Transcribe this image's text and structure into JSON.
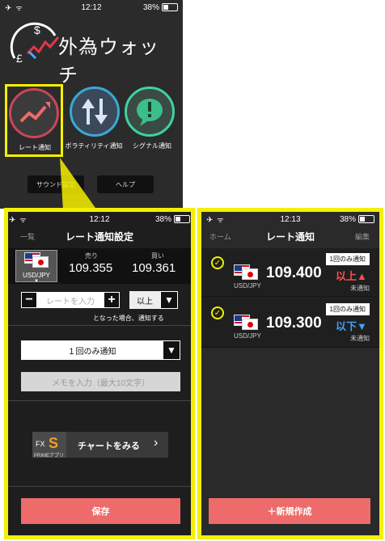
{
  "top_app": {
    "status": {
      "time": "12:12",
      "battery": "38%"
    },
    "logo_text": "外為ウォッチ",
    "buttons": [
      {
        "label": "レート通知"
      },
      {
        "label": "ボラティリティ通知"
      },
      {
        "label": "シグナル通知"
      }
    ],
    "sound_settings": "サウンド設定",
    "help": "ヘルプ"
  },
  "left": {
    "status": {
      "time": "12:12",
      "battery": "38%"
    },
    "nav": {
      "back": "一覧",
      "title": "レート通知設定"
    },
    "pair": "USD/JPY",
    "sell_label": "売り",
    "sell_value": "109.355",
    "buy_label": "買い",
    "buy_value": "109.361",
    "rate_placeholder": "レートを入力",
    "condition": "以上",
    "hint": "となった場合、通知する",
    "frequency": "１回のみ通知",
    "memo_placeholder": "メモを入力（最大10文字）",
    "chart_brand": "PRIMEアプリ",
    "chart_label": "チャートをみる",
    "save_label": "保存",
    "colors": {
      "save": "#ee6b6b"
    }
  },
  "right": {
    "status": {
      "time": "12:13",
      "battery": "38%"
    },
    "nav": {
      "home": "ホーム",
      "title": "レート通知",
      "edit": "編集"
    },
    "alerts": [
      {
        "pair": "USD/JPY",
        "rate": "109.400",
        "condition": "以上▲",
        "badge": "1回のみ通知",
        "status": "未通知",
        "cond_color": "#ff4d4d"
      },
      {
        "pair": "USD/JPY",
        "rate": "109.300",
        "condition": "以下▼",
        "badge": "1回のみ通知",
        "status": "未通知",
        "cond_color": "#3ea0ff"
      }
    ],
    "new_label": "＋新規作成"
  }
}
